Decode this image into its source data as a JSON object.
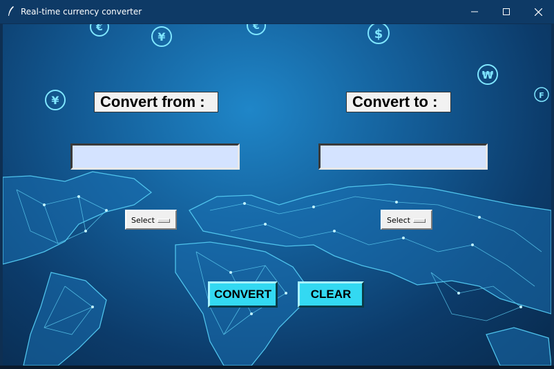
{
  "window": {
    "title": "Real-time currency converter"
  },
  "labels": {
    "from": "Convert from :",
    "to": "Convert to :"
  },
  "inputs": {
    "from_value": "",
    "to_value": ""
  },
  "selects": {
    "from_selected": "Select",
    "to_selected": "Select"
  },
  "buttons": {
    "convert": "CONVERT",
    "clear": "CLEAR"
  },
  "icons": {
    "window": [
      "app-feather-icon",
      "minimize-icon",
      "maximize-icon",
      "close-icon"
    ],
    "background": [
      "euro-coin-icon",
      "yen-coin-icon",
      "dollar-coin-icon",
      "won-coin-icon",
      "franc-coin-icon"
    ]
  },
  "colors": {
    "button_bg": "#33d9f2",
    "entry_bg": "#d4e3ff",
    "titlebar_bg": "#0e3a66",
    "network_line": "#4fc3ec"
  }
}
